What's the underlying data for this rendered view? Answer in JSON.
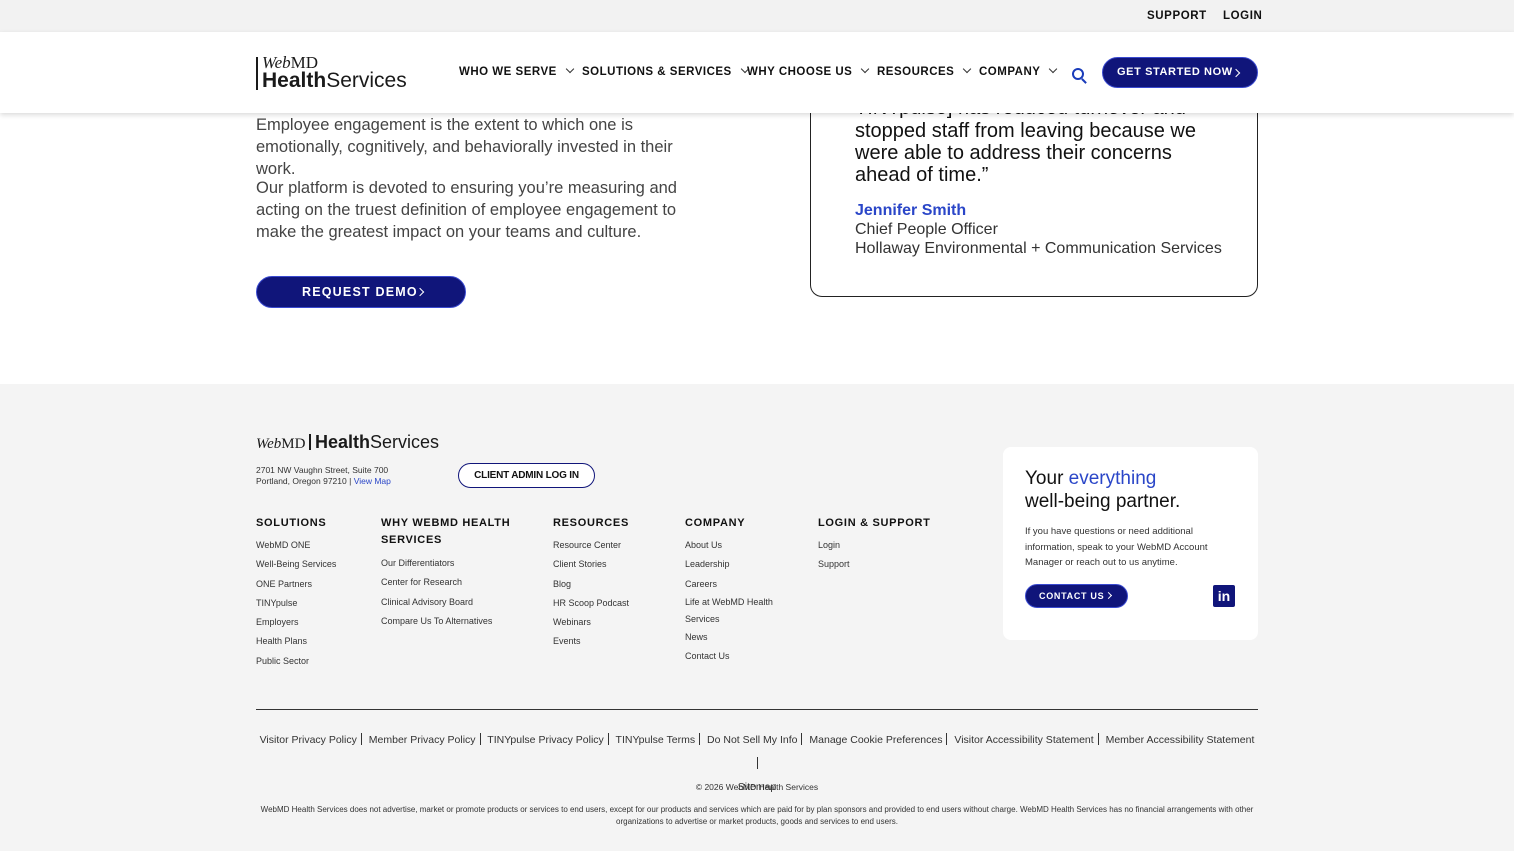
{
  "utility": {
    "support": "SUPPORT",
    "login": "LOGIN"
  },
  "header": {
    "logo_webmd_italic": "Web",
    "logo_webmd": "MD",
    "logo_health": "Health",
    "logo_services": "Services",
    "nav": [
      {
        "label": "WHO WE SERVE"
      },
      {
        "label": "SOLUTIONS & SERVICES"
      },
      {
        "label": "WHY CHOOSE US"
      },
      {
        "label": "RESOURCES"
      },
      {
        "label": "COMPANY"
      }
    ],
    "cta": "GET STARTED NOW"
  },
  "main": {
    "para1": "Employee engagement is the extent to which one is emotionally, cognitively, and behaviorally invested in their work.",
    "para2": "Our platform is devoted to ensuring you’re measuring and acting on the truest definition of employee engagement to make the greatest impact on your teams and culture.",
    "demo_button": "REQUEST DEMO"
  },
  "testimonial": {
    "quote_partial_top": "TINYpulse] has reduced turnover and",
    "quote": "stopped staff from leaving because we were able to address their concerns ahead of time.”",
    "name": "Jennifer Smith",
    "role": "Chief People Officer",
    "company": "Hollaway Environmental + Communication Services"
  },
  "footer": {
    "logo_web": "Web",
    "logo_md": "MD",
    "logo_health": "Health",
    "logo_services": "Services",
    "address_line1": "2701 NW Vaughn Street, Suite 700",
    "address_line2": "Portland, Oregon 97210 |",
    "view_map": "View Map",
    "admin_button": "CLIENT ADMIN LOG IN",
    "columns": [
      {
        "heading": "SOLUTIONS",
        "items": [
          "WebMD ONE",
          "Well-Being Services",
          "ONE Partners",
          "TINYpulse",
          "Employers",
          "Health Plans",
          "Public Sector"
        ]
      },
      {
        "heading_line1": "WHY WEBMD HEALTH",
        "heading_line2": "SERVICES",
        "items": [
          "Our Differentiators",
          "Center for Research",
          "Clinical Advisory Board",
          "Compare Us To Alternatives"
        ]
      },
      {
        "heading": "RESOURCES",
        "items": [
          "Resource Center",
          "Client Stories",
          "Blog",
          "HR Scoop Podcast",
          "Webinars",
          "Events"
        ]
      },
      {
        "heading": "COMPANY",
        "items": [
          "About Us",
          "Leadership",
          "Careers",
          "Life at WebMD Health",
          "Services",
          "News",
          "Contact Us"
        ]
      },
      {
        "heading": "LOGIN & SUPPORT",
        "items": [
          "Login",
          "Support"
        ]
      }
    ],
    "partner": {
      "title_a": "Your",
      "title_hl": "everything",
      "title_b": "well-being partner.",
      "text": "If you have questions or need additional information, speak to your WebMD Account Manager or reach out to us anytime.",
      "contact_button": "CONTACT US",
      "linkedin": "in"
    },
    "legal_links": [
      "Visitor Privacy Policy",
      "Member Privacy Policy",
      "TINYpulse Privacy Policy",
      "TINYpulse Terms",
      "Do Not Sell My Info",
      "Manage Cookie Preferences",
      "Visitor Accessibility Statement",
      "Member Accessibility Statement",
      "Sitemap"
    ],
    "copyright": "© 2026 WebMD Health Services",
    "disclaimer": "WebMD Health Services does not advertise, market or promote products or services to end users, except for our products and services which are paid for by plan sponsors and provided to end users without charge. WebMD Health Services has no financial arrangements with other organizations to advertise or market products, goods and services to end users."
  }
}
